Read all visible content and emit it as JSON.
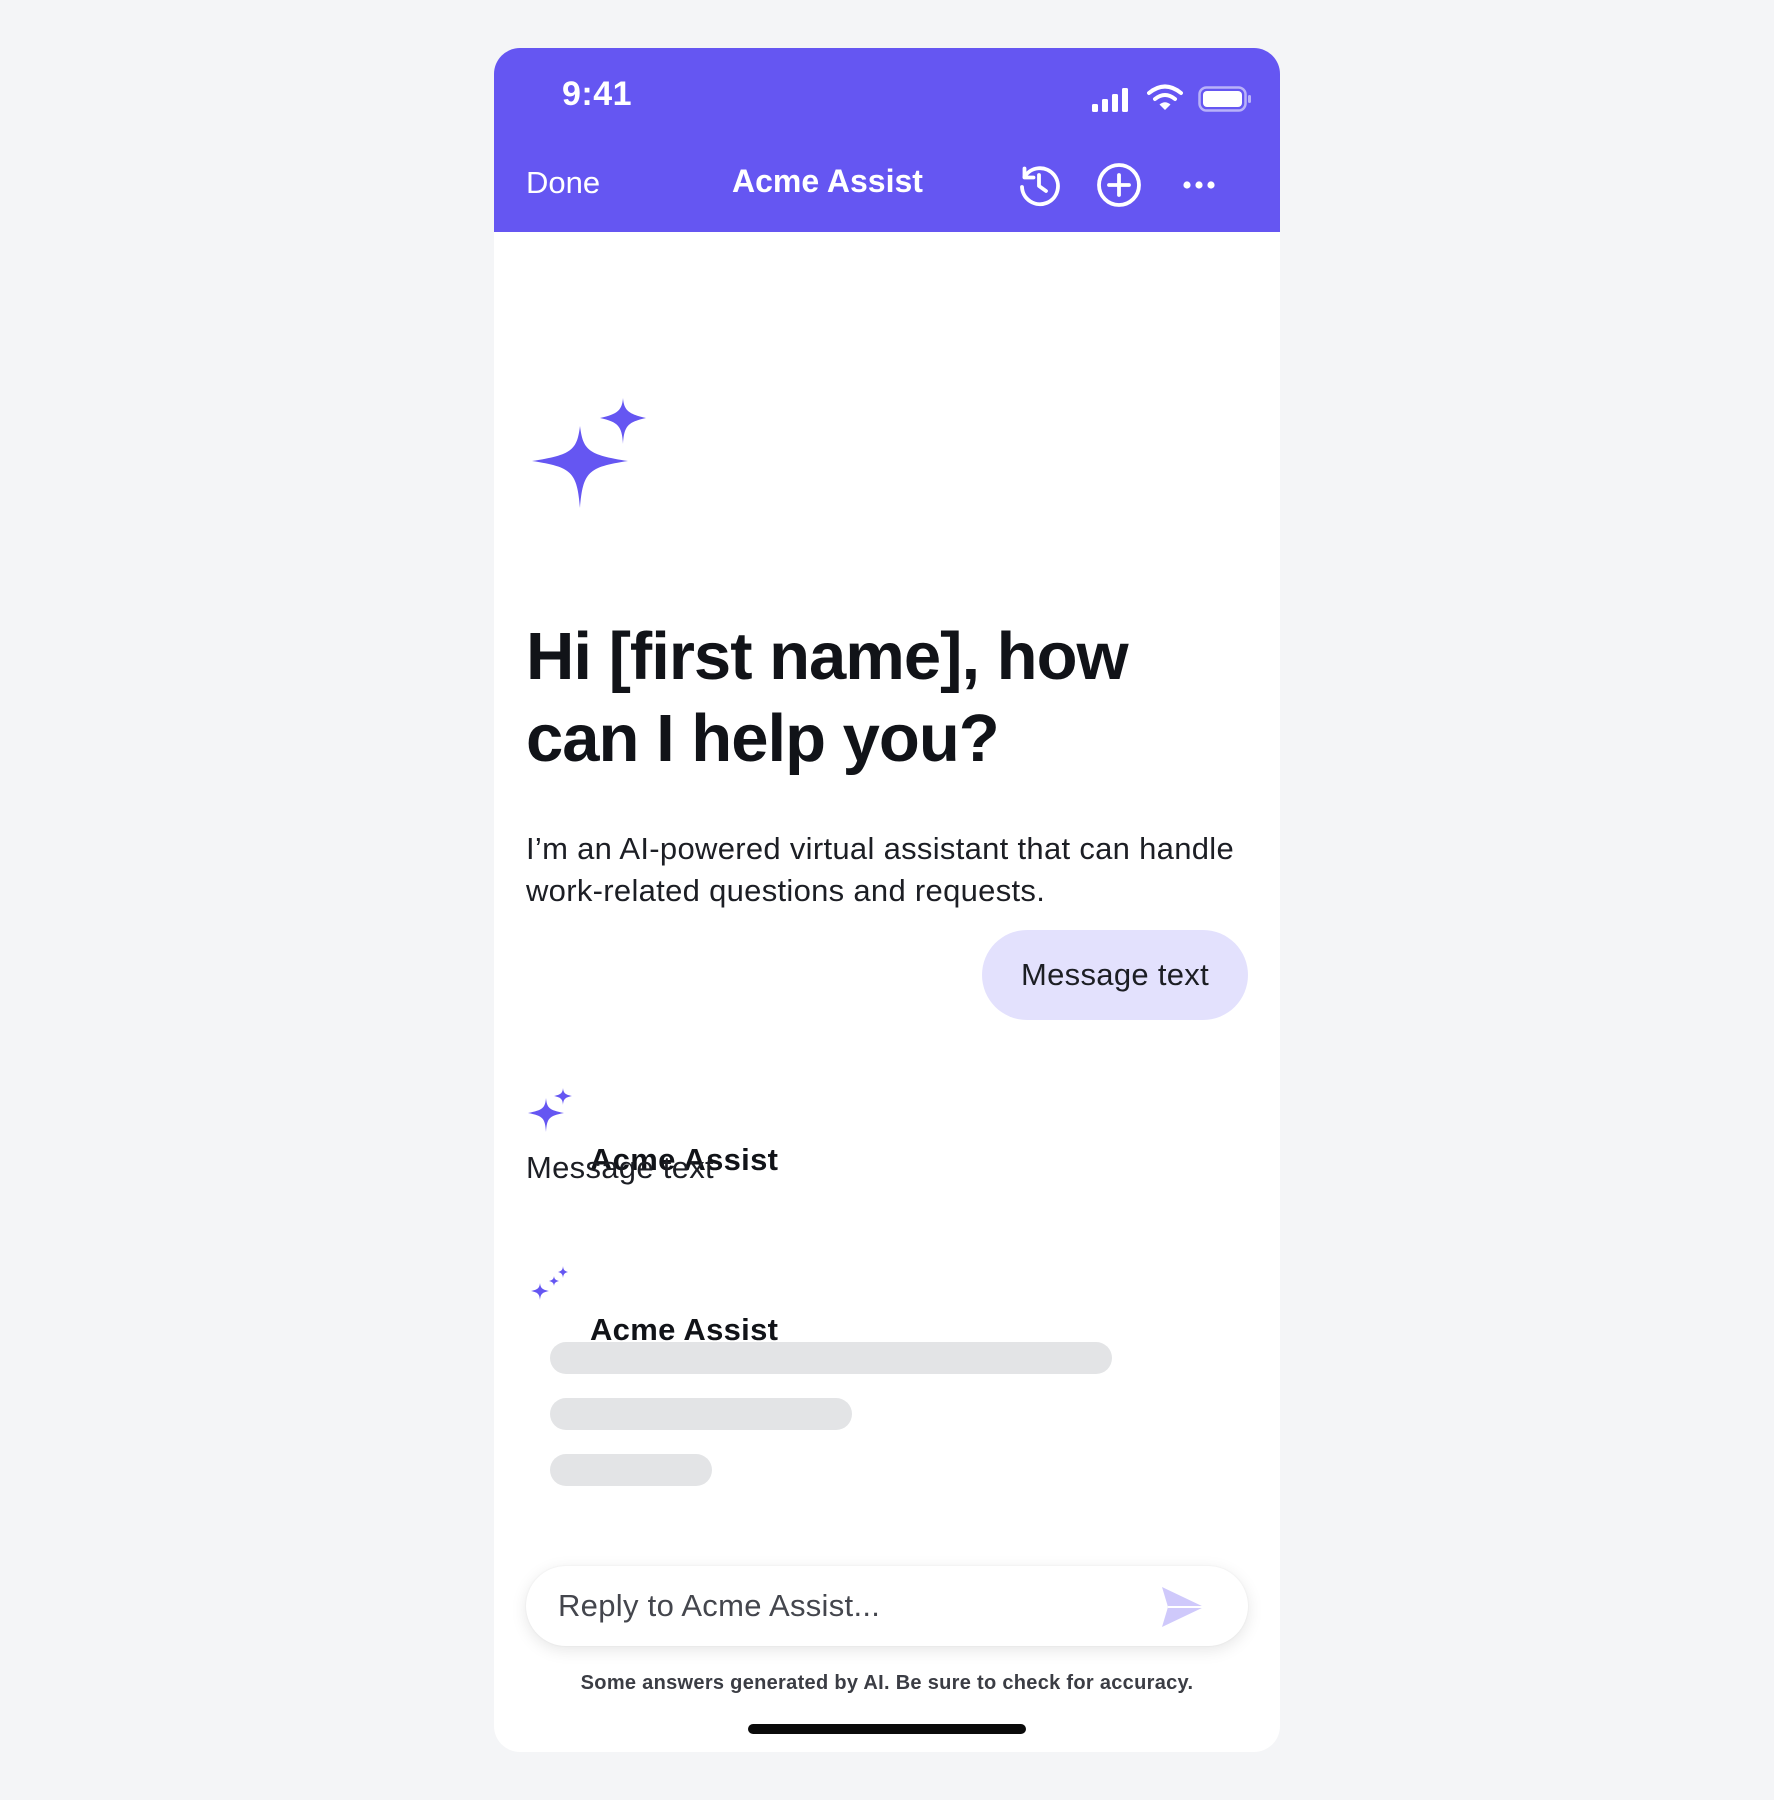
{
  "status_bar": {
    "time": "9:41"
  },
  "nav": {
    "done_label": "Done",
    "title": "Acme Assist",
    "icons": [
      "history-icon",
      "new-chat-icon",
      "more-icon"
    ]
  },
  "hero": {
    "greeting": "Hi [first name], how can I help you?",
    "intro": "I’m an AI-powered virtual assistant that can handle work-related questions and requests."
  },
  "conversation": {
    "user_message": "Message text",
    "bot_reply": {
      "name": "Acme Assist",
      "text": "Message text"
    },
    "bot_loading": {
      "name": "Acme Assist"
    }
  },
  "composer": {
    "placeholder": "Reply to Acme Assist...",
    "value": ""
  },
  "disclaimer": "Some answers generated by AI. Be sure to check for accuracy.",
  "colors": {
    "brand": "#6556f2",
    "user_bubble": "#e3e1fd",
    "skeleton": "#e3e4e6",
    "send_icon": "#cfc9fb"
  }
}
